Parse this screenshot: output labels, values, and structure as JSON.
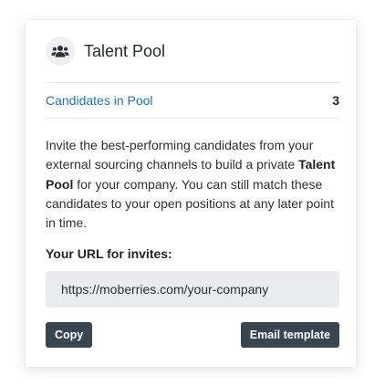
{
  "card": {
    "title": "Talent Pool",
    "icon": "users-icon"
  },
  "stats": {
    "label": "Candidates in Pool",
    "value": "3"
  },
  "description": {
    "part1": "Invite the best-performing candidates from your external sourcing channels to build a private ",
    "bold": "Talent Pool",
    "part2": " for your company. You can still match these candidates to your open positions at any later point in time."
  },
  "invite": {
    "label": "Your URL for invites:",
    "url": "https://moberries.com/your-company"
  },
  "buttons": {
    "copy": "Copy",
    "email_template": "Email template"
  },
  "colors": {
    "link": "#1f73b7",
    "button_bg": "#3a4552",
    "url_box_bg": "#e9ebee"
  }
}
